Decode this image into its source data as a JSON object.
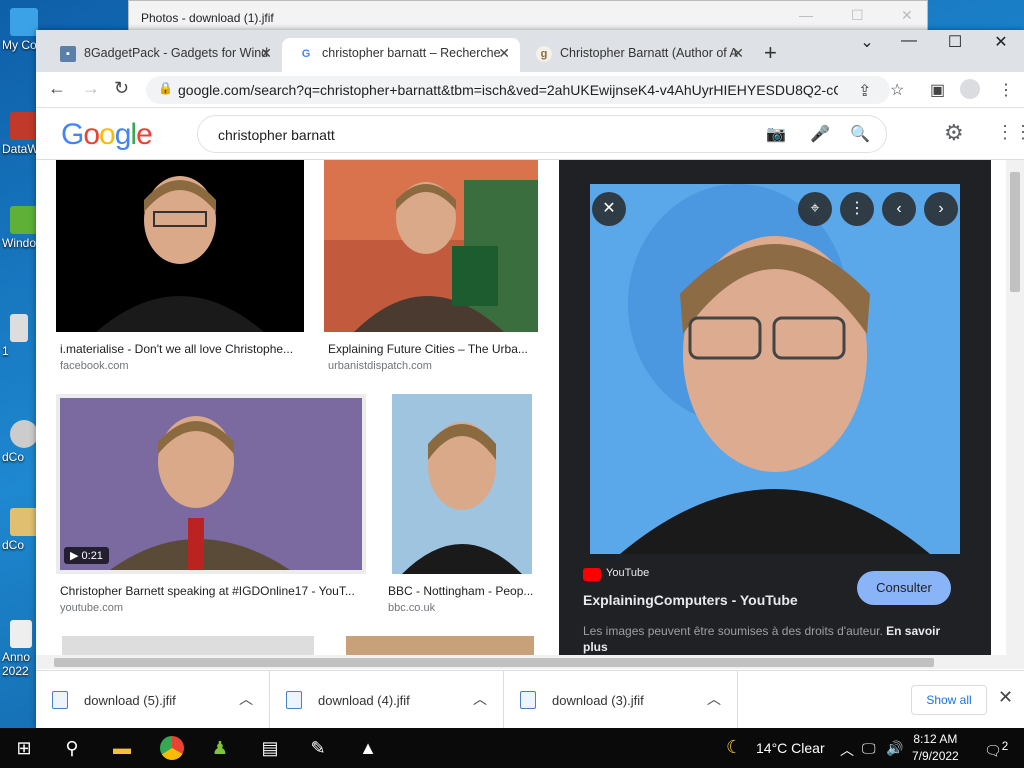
{
  "desktop": {
    "icons": [
      {
        "label": "My Co",
        "color": "#3ca2e8"
      },
      {
        "label": "DataW",
        "color": "#c0392b"
      },
      {
        "label": "Windo",
        "color": "#5fb037"
      },
      {
        "label": "1",
        "color": "#dddddd"
      },
      {
        "label": "dCo",
        "color": "#cccccc"
      },
      {
        "label": "dCo",
        "color": "#e0c070"
      },
      {
        "label": "Anno",
        "color": "#eeeeee"
      },
      {
        "label": "2022",
        "color": "#eeeeee"
      }
    ]
  },
  "photos_window": {
    "title": "Photos - download (1).jfif"
  },
  "browser": {
    "tabs": [
      {
        "label": "8GadgetPack - Gadgets for Wind",
        "icon": "gadgetpack-icon"
      },
      {
        "label": "christopher barnatt – Recherche",
        "icon": "google-icon"
      },
      {
        "label": "Christopher Barnatt (Author of A",
        "icon": "goodreads-icon"
      }
    ],
    "url": "google.com/search?q=christopher+barnatt&tbm=isch&ved=2ahUKEwijnseK4-v4AhUyrHIEHYESDU8Q2-cC..."
  },
  "google": {
    "logo_letters": [
      "G",
      "o",
      "o",
      "g",
      "l",
      "e"
    ],
    "logo_colors": [
      "#4285f4",
      "#ea4335",
      "#fbbc05",
      "#4285f4",
      "#34a853",
      "#ea4335"
    ],
    "query": "christopher barnatt"
  },
  "results": [
    {
      "caption": "i.materialise - Don't we all love Christophe...",
      "source": "facebook.com"
    },
    {
      "caption": "Explaining Future Cities – The Urba...",
      "source": "urbanistdispatch.com"
    },
    {
      "caption": "Christopher Barnett speaking at #IGDOnline17 - YouT...",
      "source": "youtube.com",
      "duration": "0:21"
    },
    {
      "caption": "BBC - Nottingham - Peop...",
      "source": "bbc.co.uk"
    }
  ],
  "panel": {
    "source": "YouTube",
    "title": "ExplainingComputers - YouTube",
    "visit_label": "Consulter",
    "notice": "Les images peuvent être soumises à des droits d'auteur.",
    "learn_more": "En savoir plus"
  },
  "downloads": {
    "items": [
      "download (5).jfif",
      "download (4).jfif",
      "download (3).jfif"
    ],
    "show_all": "Show all"
  },
  "taskbar": {
    "weather": "14°C  Clear",
    "time": "8:12 AM",
    "date": "7/9/2022",
    "notifications": "2"
  }
}
